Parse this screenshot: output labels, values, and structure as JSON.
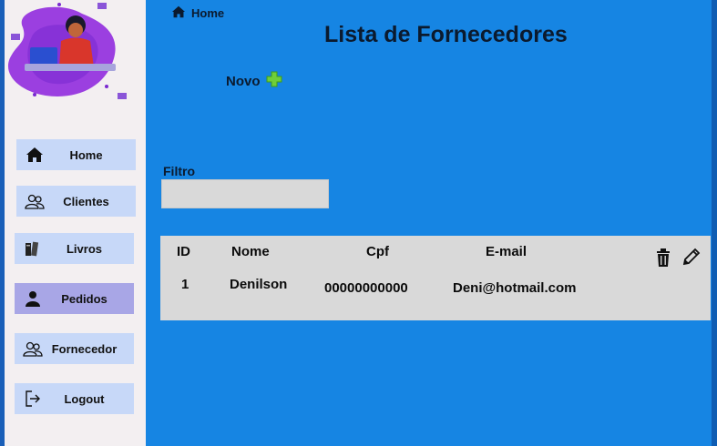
{
  "breadcrumb": {
    "label": "Home"
  },
  "page": {
    "title": "Lista de Fornecedores"
  },
  "new_button": {
    "label": "Novo"
  },
  "filter": {
    "label": "Filtro",
    "value": ""
  },
  "sidebar": {
    "items": [
      {
        "label": "Home",
        "icon": "home-icon"
      },
      {
        "label": "Clientes",
        "icon": "users-icon"
      },
      {
        "label": "Livros",
        "icon": "books-icon"
      },
      {
        "label": "Pedidos",
        "icon": "user-icon",
        "active": true
      },
      {
        "label": "Fornecedor",
        "icon": "users-icon"
      },
      {
        "label": "Logout",
        "icon": "logout-icon"
      }
    ]
  },
  "table": {
    "headers": [
      "ID",
      "Nome",
      "Cpf",
      "E-mail"
    ],
    "rows": [
      {
        "id": "1",
        "nome": "Denilson",
        "cpf": "00000000000",
        "email": "Deni@hotmail.com"
      }
    ],
    "actions": [
      "trash-icon",
      "pencil-icon"
    ]
  },
  "colors": {
    "main_bg": "#1685e3",
    "sidebar_bg": "#f3eff1",
    "nav_item_bg": "#c7d8f8",
    "nav_active_bg": "#a8a6e6",
    "table_bg": "#d9d9d9"
  }
}
